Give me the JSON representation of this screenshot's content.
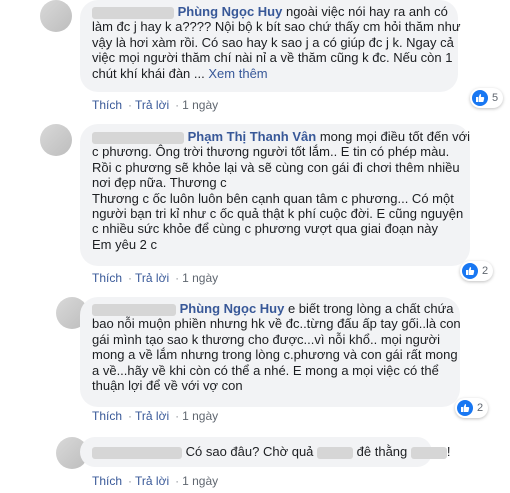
{
  "comments": [
    {
      "author": "Phùng Ngọc Huy",
      "lines": [
        "ngoài việc nói hay ra anh có",
        "làm đc j hay k a???? Nội bộ k bít sao chứ thấy cm hỏi thăm như",
        "vậy là hơi xàm rồi. Có sao hay k sao j a có giúp đc j k. Ngay cả",
        "việc mọi người thăm chí nài nỉ a về thăm cũng k đc. Nếu còn 1",
        "chút khí khái đàn"
      ],
      "ellipsis": "...",
      "see_more": "Xem thêm",
      "actions": {
        "like": "Thích",
        "reply": "Trả lời",
        "time": "1 ngày"
      },
      "reactions": {
        "icon": "like-icon",
        "count": "5"
      }
    },
    {
      "author": "Phạm Thị Thanh Vân",
      "lines": [
        "mong mọi điều tốt đến với",
        "c phương. Ông trời thương người tốt lắm.. E tin có phép màu.",
        "Rồi c phương sẽ khỏe lại và sẽ cùng con gái đi chơi thêm nhiều",
        "nơi đẹp nữa. Thương c",
        "Thương c ốc luôn luôn bên cạnh quan tâm c phương... Có một",
        "người bạn tri kỉ như c ốc quả thật k phí cuộc đời. E cũng nguyện",
        "c nhiều sức khỏe để cùng c phương vượt qua giai đoạn này",
        "Em yêu 2 c"
      ],
      "actions": {
        "like": "Thích",
        "reply": "Trả lời",
        "time": "1 ngày"
      },
      "reactions": {
        "icon": "like-icon",
        "count": "2"
      }
    },
    {
      "author": "Phùng Ngọc Huy",
      "lines": [
        "e biết trong lòng a chất chứa",
        "bao nỗi muộn phiền nhưng hk về đc..từng đấu ấp tay gối..là con",
        "gái mình tạo sao k thương cho được...vì nỗi khổ.. mọi người",
        "mong a về lắm nhưng trong lòng c.phương và con gái rất mong",
        "a về...hãy về khi còn có thể a nhé. E mong a mọi việc có thể",
        "thuận lợi để về với vợ con"
      ],
      "actions": {
        "like": "Thích",
        "reply": "Trả lời",
        "time": "1 ngày"
      },
      "reactions": {
        "icon": "like-icon",
        "count": "2"
      }
    },
    {
      "text_a": "Có sao đâu? Chờ quả",
      "text_b": "đê thằng",
      "text_c": "!",
      "actions": {
        "like": "Thích",
        "reply": "Trả lời",
        "time": "1 ngày"
      }
    }
  ],
  "colors": {
    "name": "#385898",
    "bubble": "#f2f3f5",
    "like": "#1877f2"
  }
}
